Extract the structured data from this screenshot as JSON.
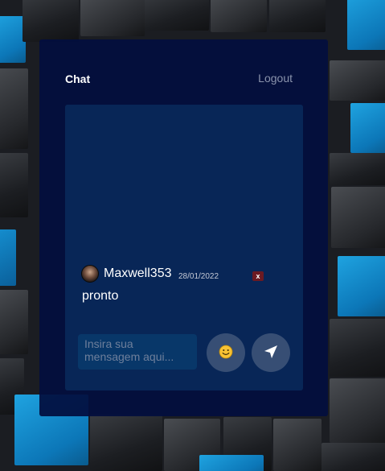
{
  "header": {
    "title": "Chat",
    "logout_label": "Logout"
  },
  "messages": [
    {
      "username": "Maxwell353",
      "date": "28/01/2022",
      "text": "pronto",
      "delete_label": "x"
    }
  ],
  "composer": {
    "placeholder": "Insira sua mensagem aqui...",
    "emoji_icon": "smiley-face-icon",
    "send_icon": "send-arrow-icon"
  },
  "colors": {
    "panel": "#020e3e",
    "chat_box": "#0c3a6e",
    "delete_button": "#6b1a22",
    "logout_text": "#8a93ac"
  }
}
